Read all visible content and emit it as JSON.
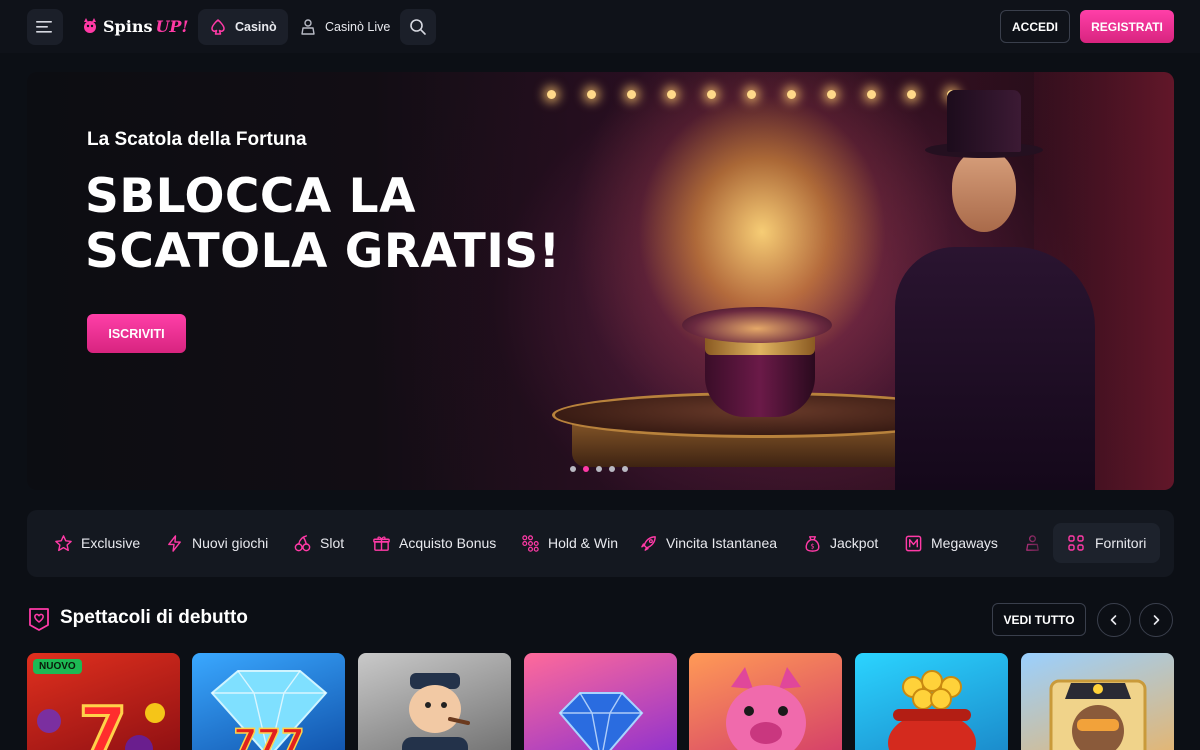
{
  "header": {
    "brand": {
      "name_left": "Spins",
      "name_right": "UP!"
    },
    "tabs": [
      {
        "label": "Casinò",
        "icon": "spade-icon",
        "active": true
      },
      {
        "label": "Casinò Live",
        "icon": "dealer-icon",
        "active": false
      }
    ],
    "login_label": "ACCEDI",
    "register_label": "REGISTRATI"
  },
  "hero": {
    "subtitle": "La Scatola della Fortuna",
    "title_line1": "SBLOCCA LA",
    "title_line2": "SCATOLA GRATIS!",
    "cta_label": "ISCRIVITI",
    "slide_count": 5,
    "active_slide": 2
  },
  "categories": [
    {
      "label": "Exclusive",
      "icon": "star-icon"
    },
    {
      "label": "Nuovi giochi",
      "icon": "lightning-icon"
    },
    {
      "label": "Slot",
      "icon": "cherries-icon"
    },
    {
      "label": "Acquisto Bonus",
      "icon": "gift-icon"
    },
    {
      "label": "Hold & Win",
      "icon": "grid-dots-icon"
    },
    {
      "label": "Vincita Istantanea",
      "icon": "rocket-icon"
    },
    {
      "label": "Jackpot",
      "icon": "money-bag-icon"
    },
    {
      "label": "Megaways",
      "icon": "m-icon"
    }
  ],
  "providers_label": "Fornitori",
  "section": {
    "title": "Spettacoli di debutto",
    "view_all_label": "VEDI TUTTO"
  },
  "games": [
    {
      "name": "fruit-sevens-slot",
      "badge": "NUOVO"
    },
    {
      "name": "diamond-777-slot",
      "badge": ""
    },
    {
      "name": "sailor-slot",
      "badge": ""
    },
    {
      "name": "blue-diamond-slot",
      "badge": ""
    },
    {
      "name": "pink-pig-slot",
      "badge": ""
    },
    {
      "name": "pot-of-gold-slot",
      "badge": ""
    },
    {
      "name": "aviator-slot",
      "badge": ""
    }
  ],
  "colors": {
    "accent": "#ff3aa6",
    "background": "#0c0f15",
    "header": "#0f1219",
    "panel": "#141820",
    "new_badge": "#1db954"
  }
}
